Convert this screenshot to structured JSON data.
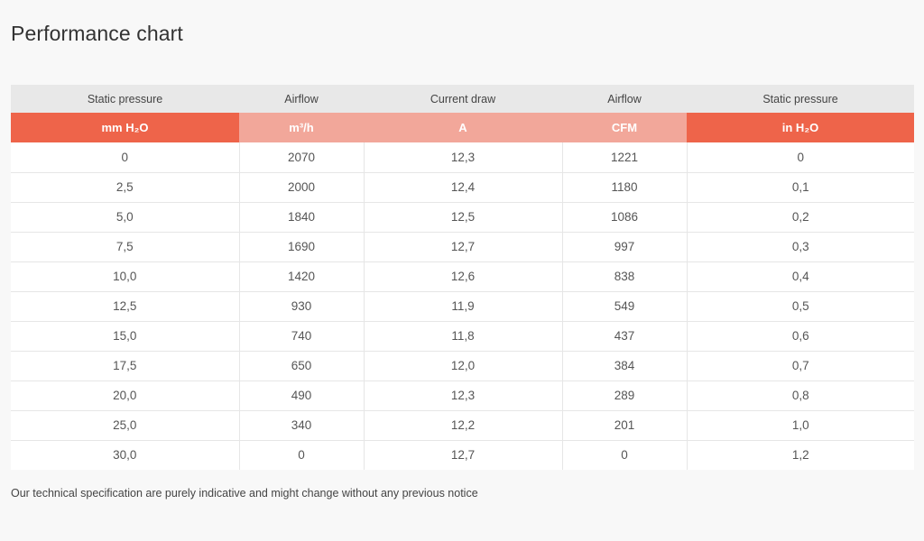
{
  "page": {
    "title": "Performance chart",
    "notice": "Our technical specification are purely indicative and might change without any previous notice"
  },
  "table": {
    "column_labels": [
      "Static pressure",
      "Airflow",
      "Current draw",
      "Airflow",
      "Static pressure"
    ],
    "column_units": [
      "mm H₂O",
      "m³/h",
      "A",
      "CFM",
      "in H₂O"
    ],
    "rows": [
      [
        "0",
        "2070",
        "12,3",
        "1221",
        "0"
      ],
      [
        "2,5",
        "2000",
        "12,4",
        "1180",
        "0,1"
      ],
      [
        "5,0",
        "1840",
        "12,5",
        "1086",
        "0,2"
      ],
      [
        "7,5",
        "1690",
        "12,7",
        "997",
        "0,3"
      ],
      [
        "10,0",
        "1420",
        "12,6",
        "838",
        "0,4"
      ],
      [
        "12,5",
        "930",
        "11,9",
        "549",
        "0,5"
      ],
      [
        "15,0",
        "740",
        "11,8",
        "437",
        "0,6"
      ],
      [
        "17,5",
        "650",
        "12,0",
        "384",
        "0,7"
      ],
      [
        "20,0",
        "490",
        "12,3",
        "289",
        "0,8"
      ],
      [
        "25,0",
        "340",
        "12,2",
        "201",
        "1,0"
      ],
      [
        "30,0",
        "0",
        "12,7",
        "0",
        "1,2"
      ]
    ]
  },
  "colors": {
    "unit_header_strong": "#ee644a",
    "unit_header_soft": "#f2a79a",
    "label_header": "#e8e8e8",
    "background": "#f8f8f8"
  }
}
